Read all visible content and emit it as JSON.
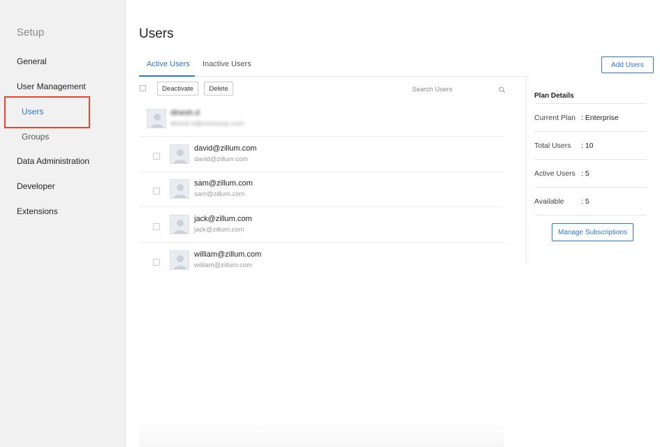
{
  "sidebar": {
    "title": "Setup",
    "items": [
      {
        "label": "General"
      },
      {
        "label": "User Management"
      },
      {
        "label": "Users"
      },
      {
        "label": "Groups"
      },
      {
        "label": "Data Administration"
      },
      {
        "label": "Developer"
      },
      {
        "label": "Extensions"
      }
    ]
  },
  "main": {
    "title": "Users",
    "tabs": [
      {
        "label": "Active Users"
      },
      {
        "label": "Inactive Users"
      }
    ],
    "add_users_label": "Add Users",
    "toolbar": {
      "deactivate_label": "Deactivate",
      "delete_label": "Delete",
      "search_placeholder": "Search Users"
    },
    "users": [
      {
        "name": "dinesh.d",
        "email": "dinesh.d@zohocorp.com"
      },
      {
        "name": "david@zillum.com",
        "email": "david@zillum.com"
      },
      {
        "name": "sam@zillum.com",
        "email": "sam@zillum.com"
      },
      {
        "name": "jack@zillum.com",
        "email": "jack@zillum.com"
      },
      {
        "name": "william@zillum.com",
        "email": "william@zillum.com"
      }
    ]
  },
  "plan": {
    "title": "Plan Details",
    "rows": [
      {
        "label": "Current Plan",
        "value": ": Enterprise"
      },
      {
        "label": "Total Users",
        "value": ": 10"
      },
      {
        "label": "Active Users",
        "value": ": 5"
      },
      {
        "label": "Available",
        "value": ": 5"
      }
    ],
    "manage_label": "Manage Subscriptions"
  },
  "colors": {
    "accent": "#2a79c9",
    "highlight": "#e8452c",
    "sidebar_bg": "#f1f1f1"
  },
  "icons": {
    "search": "search-icon",
    "avatar": "user-avatar-icon"
  }
}
